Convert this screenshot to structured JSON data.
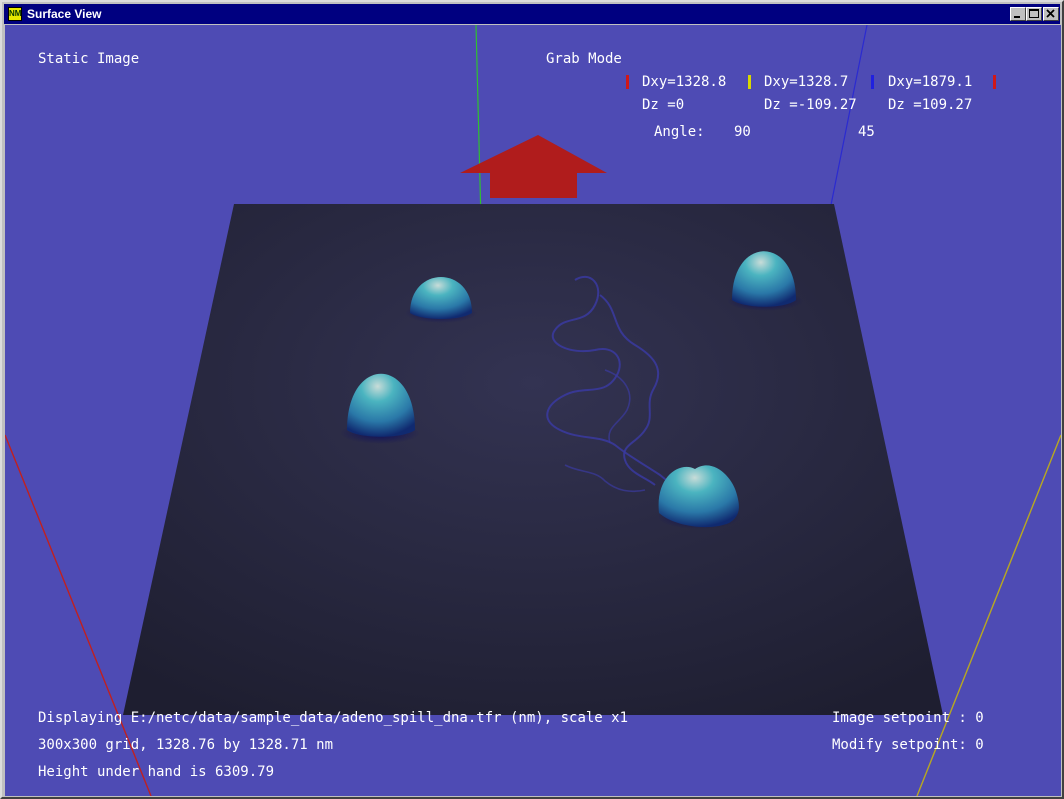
{
  "window": {
    "title": "Surface View",
    "icon_text": "NM",
    "buttons": [
      "minimize-icon",
      "maximize-icon",
      "close-icon"
    ]
  },
  "hud": {
    "mode_left": "Static Image",
    "mode_right": "Grab Mode",
    "measure": {
      "red": {
        "dxy": "Dxy=1328.8",
        "dz": "Dz =0"
      },
      "yellow": {
        "dxy": "Dxy=1328.7",
        "dz": "Dz =-109.27"
      },
      "blue": {
        "dxy": "Dxy=1879.1",
        "dz": "Dz =109.27"
      },
      "angle_label": "Angle:",
      "angle1": "90",
      "angle2": "45"
    },
    "status": {
      "displaying": "Displaying E:/netc/data/sample_data/adeno_spill_dna.tfr (nm), scale x1",
      "grid": "300x300 grid, 1328.76 by 1328.71 nm",
      "height": "Height under hand is 6309.79",
      "image_setpoint": "Image setpoint : 0",
      "modify_setpoint": "Modify setpoint: 0"
    }
  },
  "colors": {
    "background": "#4e4bb4",
    "surface": "#272740",
    "arrow": "#b01c1c",
    "marker_red": "#d01818",
    "marker_yellow": "#d8d800",
    "marker_blue": "#2020e0"
  }
}
